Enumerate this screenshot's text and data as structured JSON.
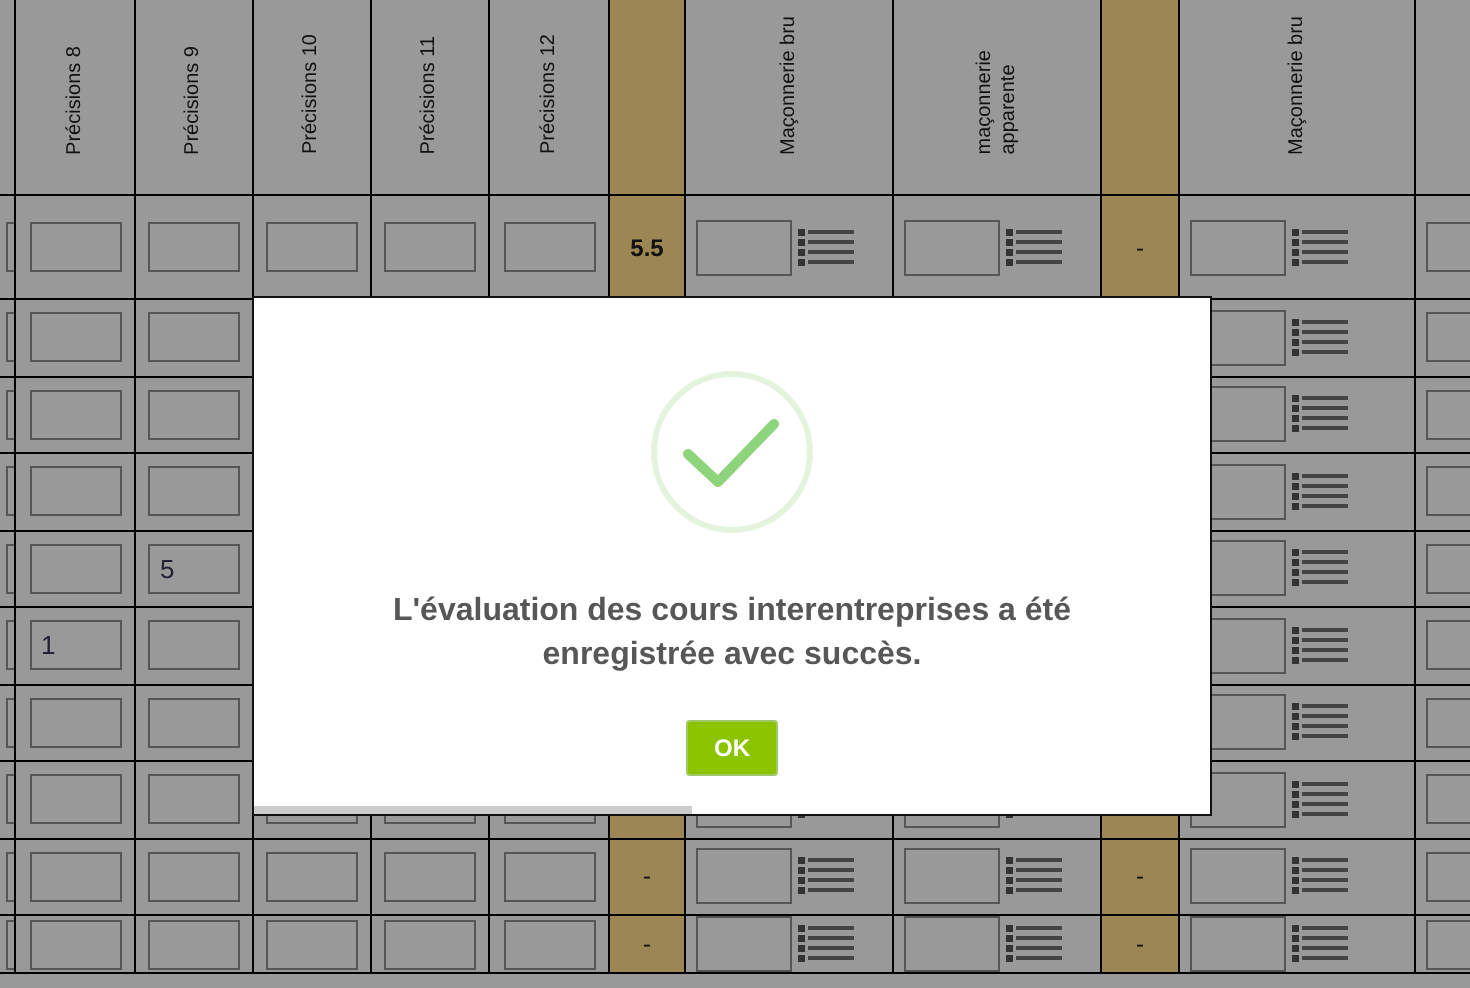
{
  "table": {
    "columns": [
      {
        "kind": "input"
      },
      {
        "kind": "input",
        "label_lines": [
          "Précisions 8"
        ]
      },
      {
        "kind": "input",
        "label_lines": [
          "Précisions 9"
        ]
      },
      {
        "kind": "input",
        "label_lines": [
          "Précisions 10"
        ]
      },
      {
        "kind": "input",
        "label_lines": [
          "Précisions 11"
        ]
      },
      {
        "kind": "input",
        "label_lines": [
          "Précisions 12"
        ]
      },
      {
        "kind": "total"
      },
      {
        "kind": "input_list",
        "label_lines": [
          "Maçonnerie bru"
        ]
      },
      {
        "kind": "input_list",
        "label_lines": [
          "maçonnerie",
          "apparente"
        ]
      },
      {
        "kind": "total"
      },
      {
        "kind": "input_list",
        "label_lines": [
          "Maçonnerie bru"
        ]
      },
      {
        "kind": "input"
      }
    ],
    "rows": [
      {
        "total_1": "5.5",
        "total_2": "-"
      },
      {},
      {},
      {},
      {
        "precisions_9": "5"
      },
      {
        "precisions_8": "1"
      },
      {},
      {},
      {
        "total_1": "-",
        "total_2": "-"
      },
      {
        "total_1": "-",
        "total_2": "-"
      }
    ]
  },
  "dialog": {
    "message": "L'évaluation des cours interentreprises a été enregistrée avec succès.",
    "button": "OK"
  }
}
